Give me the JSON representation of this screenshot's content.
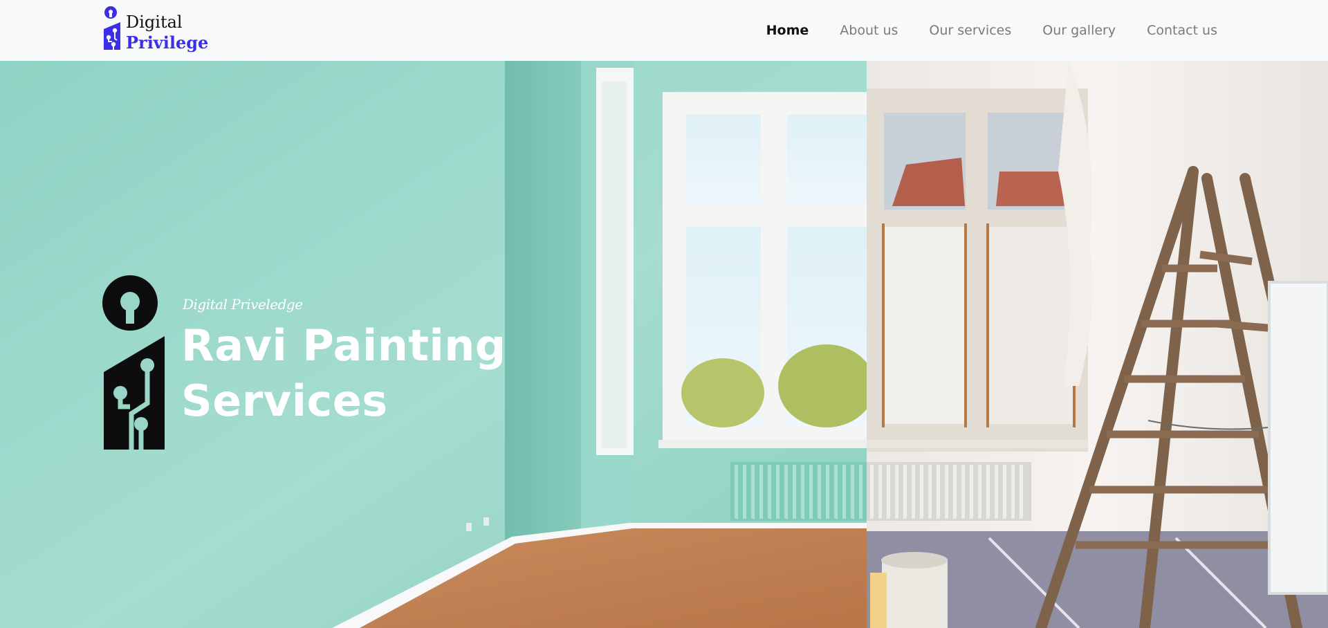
{
  "brand": {
    "line1": "Digital",
    "line2": "Privilege"
  },
  "nav": {
    "items": [
      {
        "label": "Home",
        "active": true
      },
      {
        "label": "About us",
        "active": false
      },
      {
        "label": "Our services",
        "active": false
      },
      {
        "label": "Our gallery",
        "active": false
      },
      {
        "label": "Contact us",
        "active": false
      }
    ]
  },
  "hero": {
    "tagline": "Digital Priveledge",
    "title_line1": "Ravi Painting",
    "title_line2": "Services",
    "background": "room-before-after-painting-image"
  },
  "colors": {
    "brand_blue": "#3b2ee8",
    "mint_wall": "#9ed9cc",
    "nav_bg": "#f8f9fa",
    "nav_active": "#111111",
    "nav_inactive": "#7a7a7a"
  }
}
